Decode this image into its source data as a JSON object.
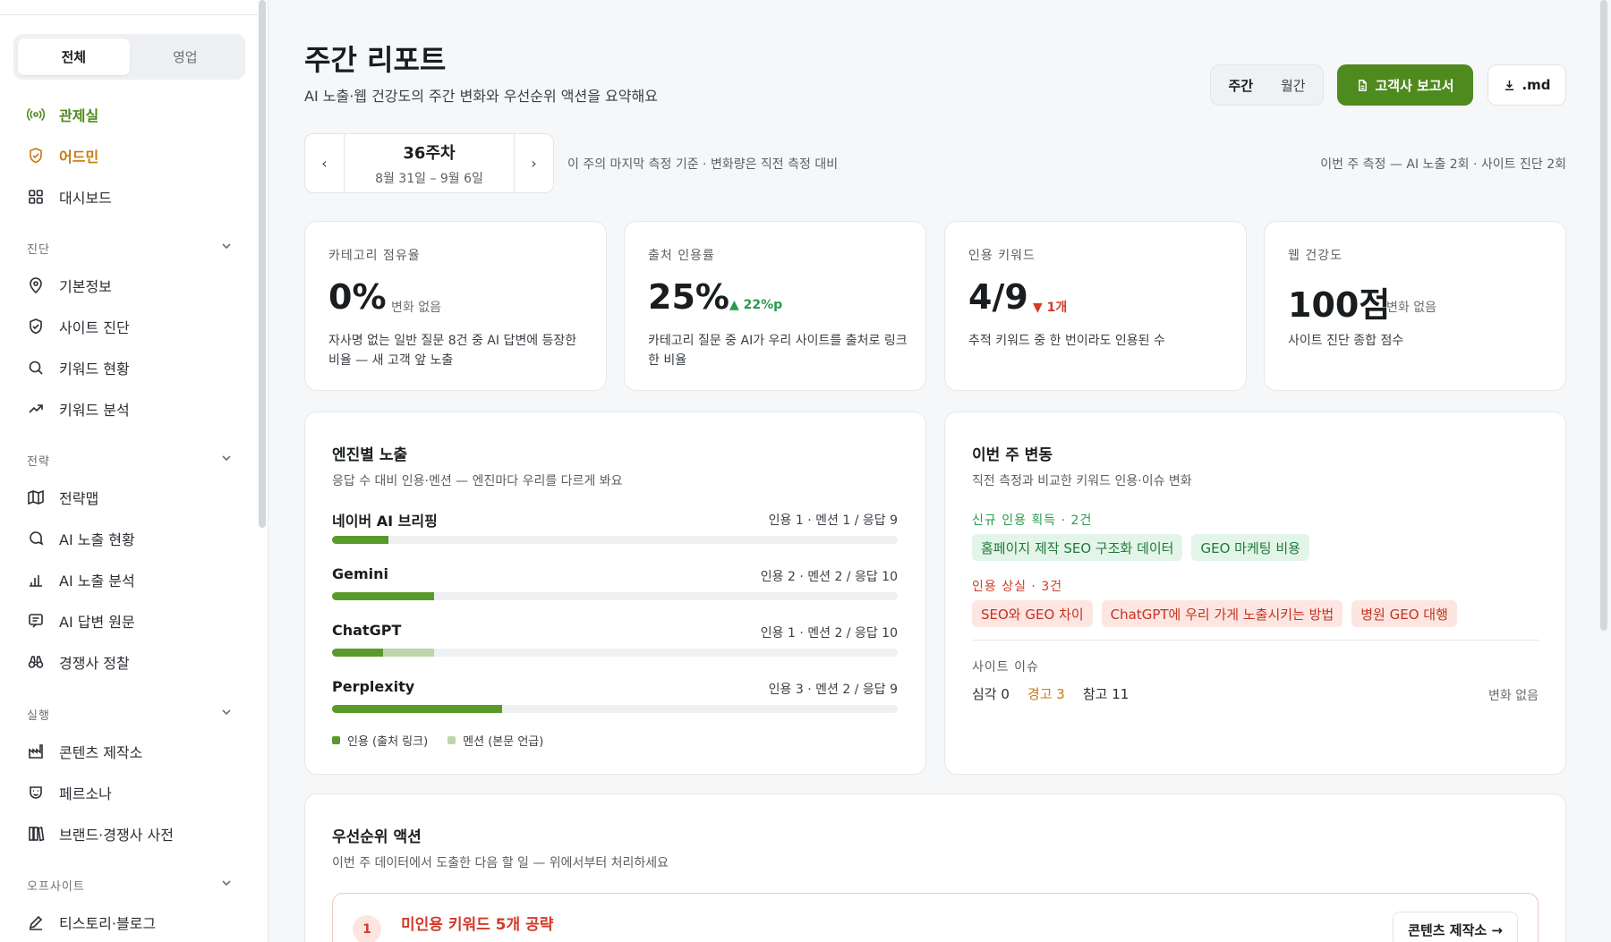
{
  "sidebar": {
    "segment": [
      "전체",
      "영업"
    ],
    "top_items": [
      {
        "label": "관제실",
        "icon": "broadcast-icon"
      },
      {
        "label": "어드민",
        "icon": "shield-icon"
      },
      {
        "label": "대시보드",
        "icon": "grid-icon"
      }
    ],
    "sections": [
      {
        "title": "진단",
        "items": [
          {
            "label": "기본정보",
            "icon": "location-pin-icon"
          },
          {
            "label": "사이트 진단",
            "icon": "shield-check-icon"
          },
          {
            "label": "키워드 현황",
            "icon": "search-icon"
          },
          {
            "label": "키워드 분석",
            "icon": "trend-up-icon"
          }
        ]
      },
      {
        "title": "전략",
        "items": [
          {
            "label": "전략맵",
            "icon": "map-icon"
          },
          {
            "label": "AI 노출 현황",
            "icon": "chat-search-icon"
          },
          {
            "label": "AI 노출 분석",
            "icon": "bar-chart-icon"
          },
          {
            "label": "AI 답변 원문",
            "icon": "message-icon"
          },
          {
            "label": "경쟁사 정찰",
            "icon": "binoculars-icon"
          }
        ]
      },
      {
        "title": "실행",
        "items": [
          {
            "label": "콘텐츠 제작소",
            "icon": "factory-icon"
          },
          {
            "label": "페르소나",
            "icon": "persona-icon"
          },
          {
            "label": "브랜드·경쟁사 사전",
            "icon": "books-icon"
          }
        ]
      },
      {
        "title": "오프사이트",
        "items": [
          {
            "label": "티스토리·블로그",
            "icon": "pen-icon"
          }
        ]
      }
    ]
  },
  "header": {
    "title": "주간 리포트",
    "subtitle": "AI 노출·웹 건강도의 주간 변화와 우선순위 액션을 요약해요",
    "period_toggle": [
      "주간",
      "월간"
    ],
    "report_button": "고객사 보고서",
    "md_button": ".md"
  },
  "week": {
    "label": "36주차",
    "range": "8월 31일 – 9월 6일",
    "prev": "‹",
    "next": "›",
    "note": "이 주의 마지막 측정 기준 · 변화량은 직전 측정 대비",
    "count": "이번 주 측정 — AI 노출 2회 · 사이트 진단 2회"
  },
  "kpis": [
    {
      "label": "카테고리 점유율",
      "value": "0%",
      "delta": "변화 없음",
      "trend": "neutral",
      "desc": "자사명 없는 일반 질문 8건 중 AI 답변에 등장한 비율 — 새 고객 앞 노출"
    },
    {
      "label": "출처 인용률",
      "value": "25%",
      "delta": "▲ 22%p",
      "trend": "up",
      "desc": "카테고리 질문 중 AI가 우리 사이트를 출처로 링크한 비율"
    },
    {
      "label": "인용 키워드",
      "value": "4/9",
      "delta": "▼ 1개",
      "trend": "down",
      "desc": "추적 키워드 중 한 번이라도 인용된 수"
    },
    {
      "label": "웹 건강도",
      "value": "100점",
      "delta": "변화 없음",
      "trend": "neutral",
      "desc": "사이트 진단 종합 점수"
    }
  ],
  "engines": {
    "title": "엔진별 노출",
    "subtitle": "응답 수 대비 인용·멘션 — 엔진마다 우리를 다르게 봐요",
    "rows": [
      {
        "name": "네이버 AI 브리핑",
        "stats": "인용 1 · 멘션 1 / 응답 9",
        "cite": 1,
        "mention": 1,
        "responses": 9
      },
      {
        "name": "Gemini",
        "stats": "인용 2 · 멘션 2 / 응답 10",
        "cite": 2,
        "mention": 2,
        "responses": 10
      },
      {
        "name": "ChatGPT",
        "stats": "인용 1 · 멘션 2 / 응답 10",
        "cite": 1,
        "mention": 2,
        "responses": 10
      },
      {
        "name": "Perplexity",
        "stats": "인용 3 · 멘션 2 / 응답 9",
        "cite": 3,
        "mention": 2,
        "responses": 9
      }
    ],
    "legend": [
      "인용 (출처 링크)",
      "멘션 (본문 언급)"
    ],
    "colors": {
      "cite": "#5a9a2a",
      "mention": "#bcd6a9"
    }
  },
  "changes": {
    "title": "이번 주 변동",
    "subtitle": "직전 측정과 비교한 키워드 인용·이슈 변화",
    "gained_head": "신규 인용 획득 · 2건",
    "gained": [
      "홈페이지 제작 SEO 구조화 데이터",
      "GEO 마케팅 비용"
    ],
    "lost_head": "인용 상실 · 3건",
    "lost": [
      "SEO와 GEO 차이",
      "ChatGPT에 우리 가게 노출시키는 방법",
      "병원 GEO 대행"
    ],
    "issue_label": "사이트 이슈",
    "issues": {
      "critical": "심각 0",
      "warning": "경고 3",
      "info": "참고 11"
    },
    "issue_change": "변화 없음"
  },
  "priority": {
    "title": "우선순위 액션",
    "subtitle": "이번 주 데이터에서 도출한 다음 할 일 — 위에서부터 처리하세요",
    "items": [
      {
        "num": "1",
        "title": "미인용 키워드 5개 공략",
        "button": "콘텐츠 제작소 →"
      }
    ]
  }
}
